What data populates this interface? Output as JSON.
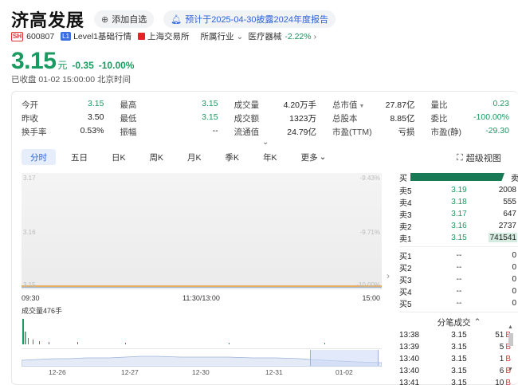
{
  "header": {
    "name": "济高发展",
    "add_watch": "添加自选",
    "forecast": "预计于2025-04-30披露2024年度报告"
  },
  "sub": {
    "exchange_badge": "SH",
    "code": "600807",
    "level_badge": "L1",
    "level_text": "Level1基础行情",
    "exchange_name": "上海交易所",
    "industry_label": "所属行业",
    "industry_value": "医疗器械",
    "industry_pct": "-2.22%"
  },
  "price": {
    "value": "3.15",
    "unit": "元",
    "change": "-0.35",
    "change_pct": "-10.00%",
    "status": "已收盘 01-02 15:00:00 北京时间"
  },
  "quote": [
    [
      [
        "今开",
        "3.15"
      ],
      [
        "最高",
        "3.15"
      ],
      [
        "成交量",
        "4.20万手"
      ],
      [
        "总市值",
        "27.87亿"
      ],
      [
        "量比",
        "0.23"
      ]
    ],
    [
      [
        "昨收",
        "3.50"
      ],
      [
        "最低",
        "3.15"
      ],
      [
        "成交额",
        "1323万"
      ],
      [
        "总股本",
        "8.85亿"
      ],
      [
        "委比",
        "-100.00%"
      ]
    ],
    [
      [
        "换手率",
        "0.53%"
      ],
      [
        "振幅",
        "--"
      ],
      [
        "流通值",
        "24.79亿"
      ],
      [
        "市盈(TTM)",
        "亏损"
      ],
      [
        "市盈(静)",
        "-29.30"
      ]
    ]
  ],
  "tabs": [
    "分时",
    "五日",
    "日K",
    "周K",
    "月K",
    "季K",
    "年K",
    "更多"
  ],
  "super_chart": "超级视图",
  "chart": {
    "y_left": [
      "3.17",
      "3.16",
      "3.15"
    ],
    "y_right": [
      "-9.43%",
      "-9.71%",
      "-10.00%"
    ],
    "x_labels": [
      "09:30",
      "11:30/13:00",
      "15:00"
    ],
    "volume_label": "成交量476手",
    "dates": [
      "12-26",
      "12-27",
      "12-30",
      "12-31",
      "01-02"
    ]
  },
  "orderbook": {
    "buy_label": "买",
    "sell_label": "卖",
    "asks": [
      {
        "name": "卖5",
        "price": "3.19",
        "vol": "2008"
      },
      {
        "name": "卖4",
        "price": "3.18",
        "vol": "555"
      },
      {
        "name": "卖3",
        "price": "3.17",
        "vol": "647"
      },
      {
        "name": "卖2",
        "price": "3.16",
        "vol": "2737"
      },
      {
        "name": "卖1",
        "price": "3.15",
        "vol": "741541"
      }
    ],
    "bids": [
      {
        "name": "买1",
        "price": "--",
        "vol": "0"
      },
      {
        "name": "买2",
        "price": "--",
        "vol": "0"
      },
      {
        "name": "买3",
        "price": "--",
        "vol": "0"
      },
      {
        "name": "买4",
        "price": "--",
        "vol": "0"
      },
      {
        "name": "买5",
        "price": "--",
        "vol": "0"
      }
    ]
  },
  "ticks": {
    "title": "分笔成交",
    "rows": [
      {
        "t": "13:38",
        "p": "3.15",
        "v": "51",
        "d": "B"
      },
      {
        "t": "13:39",
        "p": "3.15",
        "v": "5",
        "d": "B"
      },
      {
        "t": "13:40",
        "p": "3.15",
        "v": "1",
        "d": "B"
      },
      {
        "t": "13:40",
        "p": "3.15",
        "v": "6",
        "d": "B"
      },
      {
        "t": "13:41",
        "p": "3.15",
        "v": "10",
        "d": "B"
      }
    ]
  },
  "colors": {
    "down": "#1a9a60",
    "up": "#e03030",
    "accent": "#2b63d9"
  }
}
